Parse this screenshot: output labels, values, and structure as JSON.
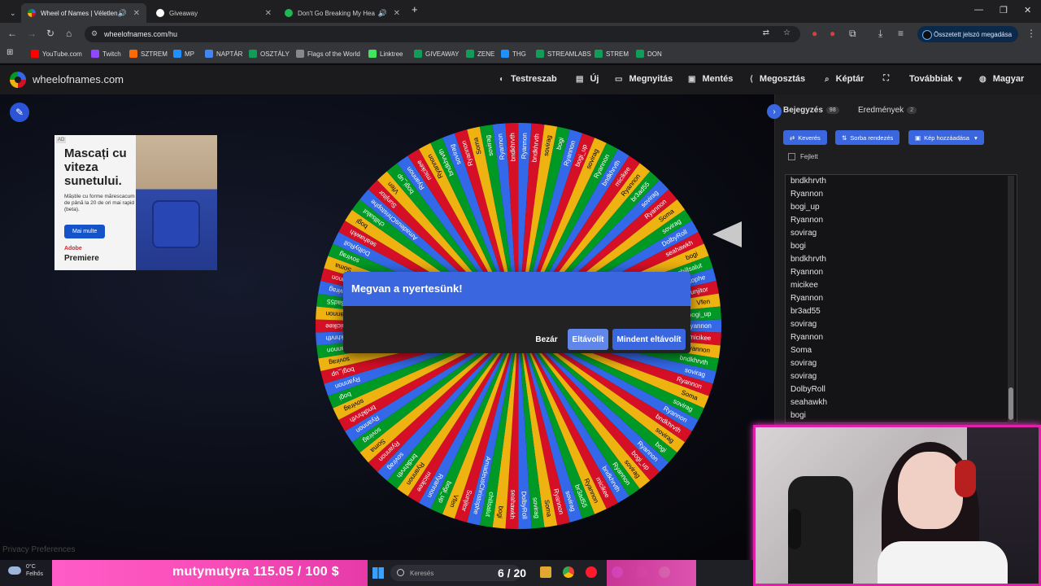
{
  "browser": {
    "tabs": [
      {
        "title": "Wheel of Names | Véletlen",
        "active": true,
        "color": "#3369e8"
      },
      {
        "title": "Giveaway",
        "active": false,
        "color": "#ffffff"
      },
      {
        "title": "Don't Go Breaking My Hea",
        "active": false,
        "color": "#1db954"
      }
    ],
    "new_tab": "+",
    "url": "wheelofnames.com/hu",
    "password_button": "Összetett jelszó megadása",
    "bookmarks": [
      {
        "label": "YouTube.com",
        "color": "#ff0000"
      },
      {
        "label": "Twitch",
        "color": "#9146ff"
      },
      {
        "label": "SZTREM",
        "color": "#ff6a00"
      },
      {
        "label": "MP",
        "color": "#1e90ff"
      },
      {
        "label": "NAPTÁR",
        "color": "#4285f4"
      },
      {
        "label": "OSZTÁLY",
        "color": "#0f9d58"
      },
      {
        "label": "Flags of the World",
        "color": "#888888"
      },
      {
        "label": "Linktree",
        "color": "#43e55e"
      },
      {
        "label": "GIVEAWAY",
        "color": "#0f9d58"
      },
      {
        "label": "ZENE",
        "color": "#0f9d58"
      },
      {
        "label": "THG",
        "color": "#1e90ff"
      },
      {
        "label": "STREAMLABS",
        "color": "#0f9d58"
      },
      {
        "label": "STREM",
        "color": "#0f9d58"
      },
      {
        "label": "DON",
        "color": "#0f9d58"
      }
    ]
  },
  "site": {
    "name": "wheelofnames.com",
    "menu": [
      {
        "label": "Testreszab",
        "icon": "palette-icon"
      },
      {
        "label": "Új",
        "icon": "file-icon"
      },
      {
        "label": "Megnyitás",
        "icon": "folder-icon"
      },
      {
        "label": "Mentés",
        "icon": "save-icon"
      },
      {
        "label": "Megosztás",
        "icon": "share-icon"
      },
      {
        "label": "Képtár",
        "icon": "search-icon"
      },
      {
        "label": "",
        "icon": "fullscreen-icon"
      },
      {
        "label": "Továbbiak",
        "icon": "chevron-down-icon"
      },
      {
        "label": "Magyar",
        "icon": "globe-icon"
      }
    ]
  },
  "ad": {
    "tag": "AD",
    "headline": "Mascați cu viteza sunetului.",
    "body": "Măștile cu forme mărescacum de până la 20 de ori mai rapid (beta).",
    "button": "Mai multe",
    "brand": "Adobe",
    "product": "Premiere"
  },
  "wheel": {
    "colors": [
      "#3369e8",
      "#d50f25",
      "#eeb211",
      "#009925"
    ],
    "segments": 98,
    "labels": [
      "Ryannon",
      "bndkhrvth",
      "sovirag",
      "bogi",
      "Ryannon",
      "bogi_up",
      "sovirag",
      "Ryannon",
      "bndkhrvth",
      "micikee",
      "Ryannon",
      "br3ad55",
      "sovirag",
      "Ryannon",
      "Soma",
      "sovirag",
      "DolbyRoll",
      "seahawkh",
      "bogi",
      "chillsalut",
      "AmadeusChristophe",
      "Sunjitor",
      "Vfen",
      "bogi_up",
      "Ryannon",
      "micikee",
      "Ryannon",
      "bndkhrvth",
      "sovirag",
      "Ryannon",
      "Soma",
      "sovirag"
    ]
  },
  "dialog": {
    "title": "Megvan a nyertesünk!",
    "close": "Bezár",
    "remove": "Eltávolít",
    "remove_all": "Mindent eltávolít"
  },
  "panel": {
    "tab_entries": "Bejegyzés",
    "entries_count": "98",
    "tab_results": "Eredmények",
    "results_count": "2",
    "shuffle": "Keverés",
    "sort": "Sorba rendezés",
    "add_image": "Kép hozzáadása",
    "advanced": "Fejlett",
    "entries": [
      "bndkhrvth",
      "Ryannon",
      "bogi_up",
      "Ryannon",
      "sovirag",
      "bogi",
      "bndkhrvth",
      "Ryannon",
      "micikee",
      "Ryannon",
      "br3ad55",
      "sovirag",
      "Ryannon",
      "Soma",
      "sovirag",
      "sovirag",
      "DolbyRoll",
      "seahawkh",
      "bogi"
    ]
  },
  "privacy": "Privacy Preferences",
  "overlay": {
    "temp": "0°C",
    "weather": "Felhős",
    "goal_text": "mutymutyra  115.05  /  100  $",
    "search_placeholder": "Keresés",
    "counter": "6 / 20"
  }
}
